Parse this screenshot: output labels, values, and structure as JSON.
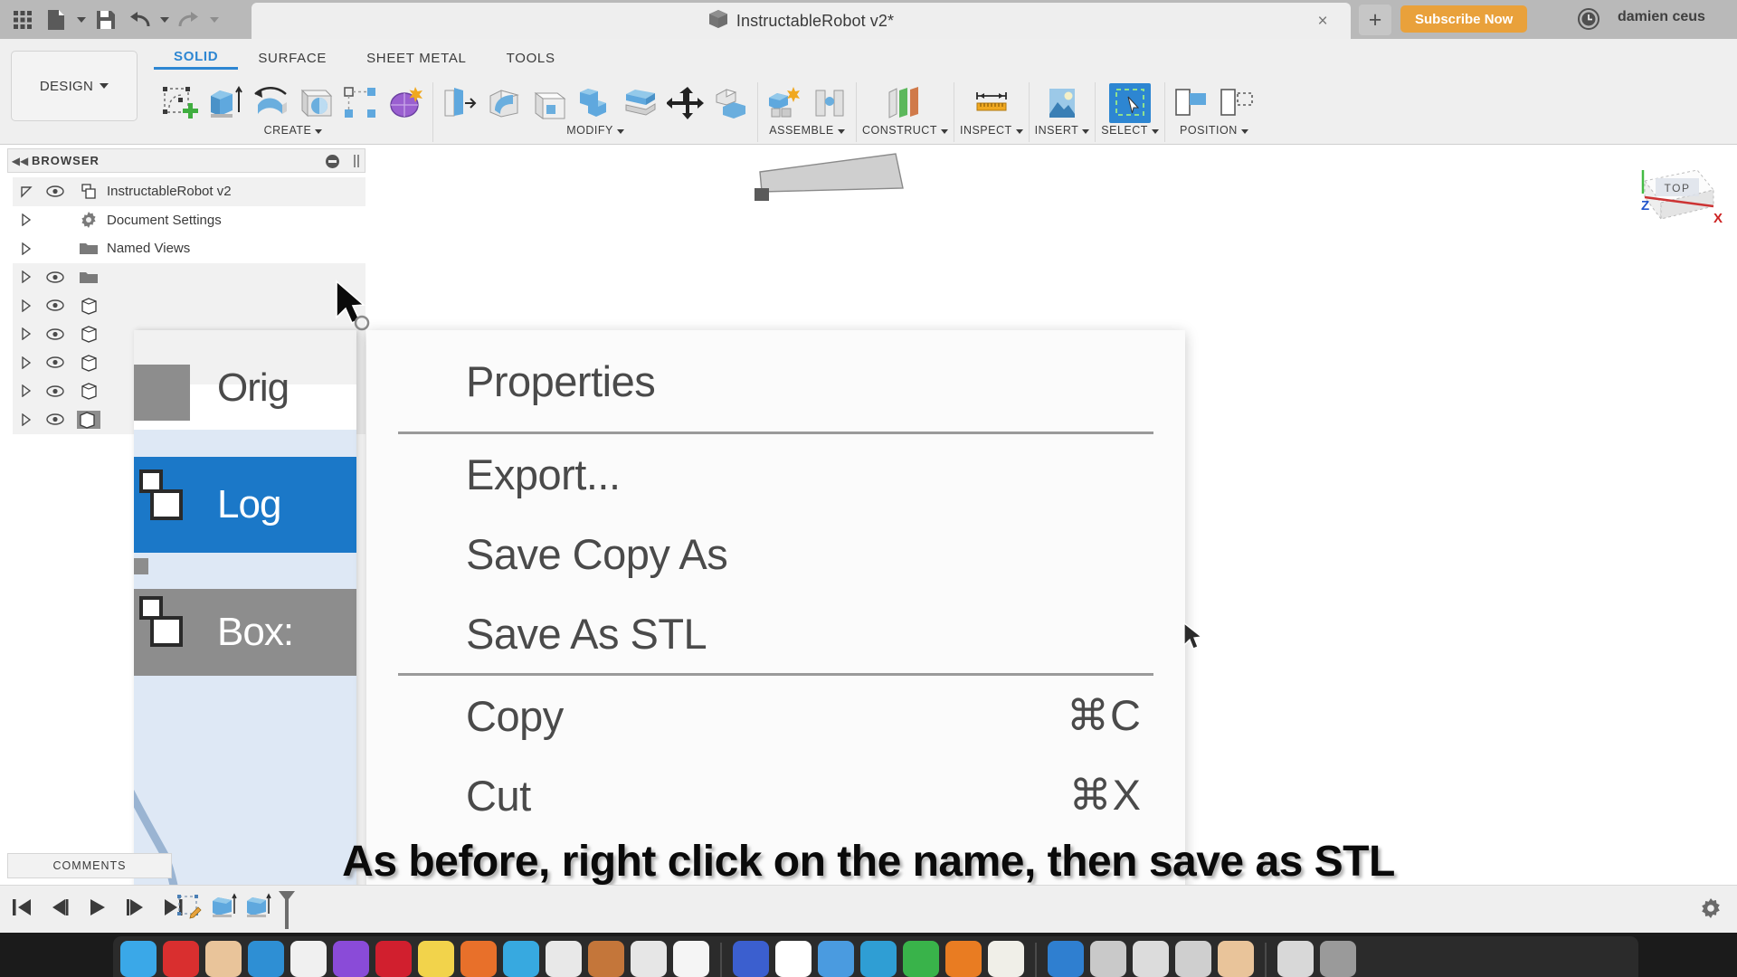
{
  "app": {
    "name": "Autodesk Fusion 360",
    "document_title": "InstructableRobot v2*"
  },
  "topbar": {
    "grid_icon": "app-grid-icon",
    "new_icon": "new-document-icon",
    "save_icon": "save-icon",
    "undo_icon": "undo-icon",
    "redo_icon": "redo-icon",
    "tab_close_label": "×",
    "new_tab_label": "+",
    "subscribe_label": "Subscribe Now",
    "clock_icon": "clock-icon",
    "username": "damien ceus",
    "help_icon": "help-icon"
  },
  "ribbon": {
    "workspace_label": "DESIGN",
    "tabs": [
      {
        "label": "SOLID",
        "active": true
      },
      {
        "label": "SURFACE",
        "active": false
      },
      {
        "label": "SHEET METAL",
        "active": false
      },
      {
        "label": "TOOLS",
        "active": false
      }
    ],
    "groups": [
      {
        "label": "CREATE",
        "icons": [
          "sketch-create-icon",
          "extrude-icon",
          "revolve-icon",
          "sphere-icon",
          "pattern-icon",
          "create-form-icon"
        ]
      },
      {
        "label": "MODIFY",
        "icons": [
          "press-pull-icon",
          "fillet-icon",
          "shell-icon",
          "combine-icon",
          "offset-face-icon",
          "move-copy-icon",
          "split-body-icon"
        ]
      },
      {
        "label": "ASSEMBLE",
        "icons": [
          "new-component-icon",
          "joint-icon"
        ]
      },
      {
        "label": "CONSTRUCT",
        "icons": [
          "offset-plane-icon"
        ]
      },
      {
        "label": "INSPECT",
        "icons": [
          "measure-icon"
        ]
      },
      {
        "label": "INSERT",
        "icons": [
          "insert-image-icon"
        ]
      },
      {
        "label": "SELECT",
        "icons": [
          "select-window-icon"
        ]
      },
      {
        "label": "POSITION",
        "icons": [
          "align-icon",
          "position-icon"
        ]
      }
    ]
  },
  "browser": {
    "panel_title": "BROWSER",
    "collapse_icon": "collapse-left-icon",
    "minimize_icon": "minimize-icon",
    "grip_icon": "grip-icon",
    "rows": [
      {
        "label": "InstructableRobot v2",
        "arrow": "expanded",
        "eye": true,
        "icon": "assembly-icon"
      },
      {
        "label": "Document Settings",
        "arrow": "collapsed",
        "eye": false,
        "icon": "gear-icon"
      },
      {
        "label": "Named Views",
        "arrow": "collapsed",
        "eye": false,
        "icon": "folder-icon"
      },
      {
        "label": "",
        "arrow": "collapsed",
        "eye": true,
        "icon": "folder-icon"
      },
      {
        "label": "",
        "arrow": "collapsed",
        "eye": true,
        "icon": "body-icon"
      },
      {
        "label": "",
        "arrow": "collapsed",
        "eye": true,
        "icon": "body-icon"
      },
      {
        "label": "",
        "arrow": "collapsed",
        "eye": true,
        "icon": "body-icon"
      },
      {
        "label": "",
        "arrow": "collapsed",
        "eye": true,
        "icon": "body-icon"
      },
      {
        "label": "",
        "arrow": "collapsed",
        "eye": true,
        "icon": "body-icon-selected"
      }
    ]
  },
  "magnifier": {
    "rows": [
      {
        "text": "Orig",
        "state": "normal"
      },
      {
        "text": "Log",
        "state": "selected"
      },
      {
        "text": "Box:",
        "state": "gray"
      }
    ]
  },
  "context_menu": {
    "items": [
      {
        "label": "Properties",
        "shortcut": ""
      },
      {
        "separator": true
      },
      {
        "label": "Export...",
        "shortcut": ""
      },
      {
        "label": "Save Copy As",
        "shortcut": ""
      },
      {
        "label": "Save As STL",
        "shortcut": ""
      },
      {
        "separator": true
      },
      {
        "label": "Copy",
        "shortcut": "⌘C"
      },
      {
        "label": "Cut",
        "shortcut": "⌘X"
      }
    ]
  },
  "viewcube": {
    "face_label": "TOP",
    "axis_z": "Z",
    "axis_x": "X"
  },
  "caption": {
    "text": "As before, right click on the name, then save as STL"
  },
  "bottom": {
    "comments_label": "COMMENTS",
    "timeline_buttons": [
      "skip-to-start-icon",
      "step-back-icon",
      "play-icon",
      "step-forward-icon",
      "skip-to-end-icon"
    ],
    "timeline_marks": [
      "sketch-marker-icon",
      "extrude-marker-icon",
      "extrude-marker-icon",
      "timeline-end-marker-icon"
    ],
    "settings_icon": "gear-icon"
  },
  "colors": {
    "accent_blue": "#2d86d2",
    "selection_blue": "#1b78c8",
    "subscribe_orange": "#e9a13b",
    "topbar_gray": "#b9b9b9",
    "ribbon_gray": "#efefef"
  },
  "dock": {
    "icons": [
      "#3aa8e8",
      "#d92f2f",
      "#e9c49a",
      "#2e8fd4",
      "#f0f0f0",
      "#8a4bd8",
      "#d11f2e",
      "#f2d34b",
      "#e8702a",
      "#37a9e0",
      "#e8e8e8",
      "#c4763a",
      "#e6e6e6",
      "#f5f5f5",
      "#3b5fcf",
      "#ffffff",
      "#4a9be0",
      "#2f9ed4",
      "#39b34a",
      "#e97c22",
      "#f0efe8",
      "#2f7fd0",
      "#c9c9c9",
      "#dcdcdc",
      "#cfcfcf",
      "#e9c49a",
      "#d8d8d8",
      "#9a9a9a"
    ]
  }
}
